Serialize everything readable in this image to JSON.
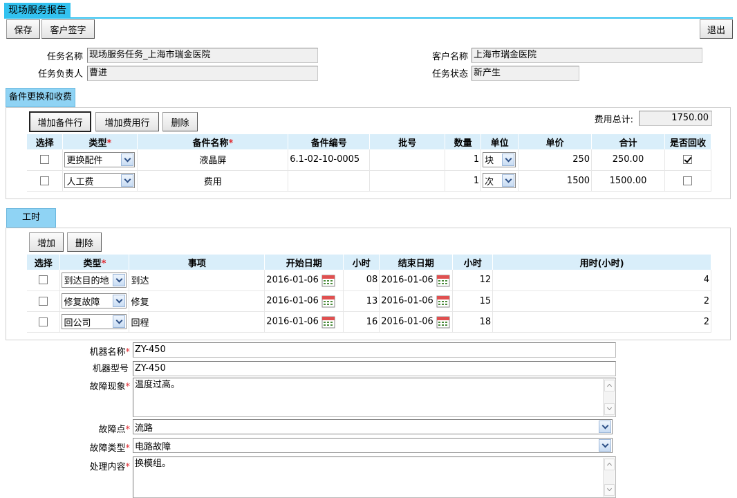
{
  "page": {
    "title": "现场服务报告"
  },
  "toolbar": {
    "save": "保存",
    "sign": "客户签字",
    "exit": "退出"
  },
  "header": {
    "task_name_label": "任务名称",
    "task_name": "现场服务任务_上海市瑞金医院",
    "owner_label": "任务负责人",
    "owner": "曹进",
    "customer_label": "客户名称",
    "customer": "上海市瑞金医院",
    "status_label": "任务状态",
    "status": "新产生"
  },
  "parts": {
    "tab": "备件更换和收费",
    "add_part": "增加备件行",
    "add_fee": "增加费用行",
    "delete": "删除",
    "total_label": "费用总计:",
    "total": "1750.00",
    "columns": [
      "选择",
      "类型",
      "备件名称",
      "备件编号",
      "批号",
      "数量",
      "单位",
      "单价",
      "合计",
      "是否回收"
    ],
    "rows": [
      {
        "type": "更换配件",
        "name": "液晶屏",
        "code": "6.1-02-10-0005",
        "batch": "",
        "qty": "1",
        "unit": "块",
        "price": "250",
        "sum": "250.00",
        "recycle": true
      },
      {
        "type": "人工费",
        "name": "费用",
        "code": "",
        "batch": "",
        "qty": "1",
        "unit": "次",
        "price": "1500",
        "sum": "1500.00",
        "recycle": false
      }
    ]
  },
  "hours": {
    "tab": "工时",
    "add": "增加",
    "delete": "删除",
    "columns": [
      "选择",
      "类型",
      "事项",
      "开始日期",
      "小时",
      "结束日期",
      "小时",
      "用时(小时)"
    ],
    "rows": [
      {
        "type": "到达目的地",
        "item": "到达",
        "start": "2016-01-06",
        "sh": "08",
        "end": "2016-01-06",
        "eh": "12",
        "used": "4"
      },
      {
        "type": "修复故障",
        "item": "修复",
        "start": "2016-01-06",
        "sh": "13",
        "end": "2016-01-06",
        "eh": "15",
        "used": "2"
      },
      {
        "type": "回公司",
        "item": "回程",
        "start": "2016-01-06",
        "sh": "16",
        "end": "2016-01-06",
        "eh": "18",
        "used": "2"
      }
    ]
  },
  "machine": {
    "name_label": "机器名称",
    "name": "ZY-450",
    "model_label": "机器型号",
    "model": "ZY-450",
    "symptom_label": "故障现象",
    "symptom": "温度过高。",
    "point_label": "故障点",
    "point": "流路",
    "fault_type_label": "故障类型",
    "fault_type": "电路故障",
    "handling_label": "处理内容",
    "handling": "换模组。"
  },
  "colors": {
    "accent": "#33c2f0",
    "tab_bg": "#8fd3f4",
    "header_bg": "#d9eefa",
    "required": "#e0282e"
  }
}
